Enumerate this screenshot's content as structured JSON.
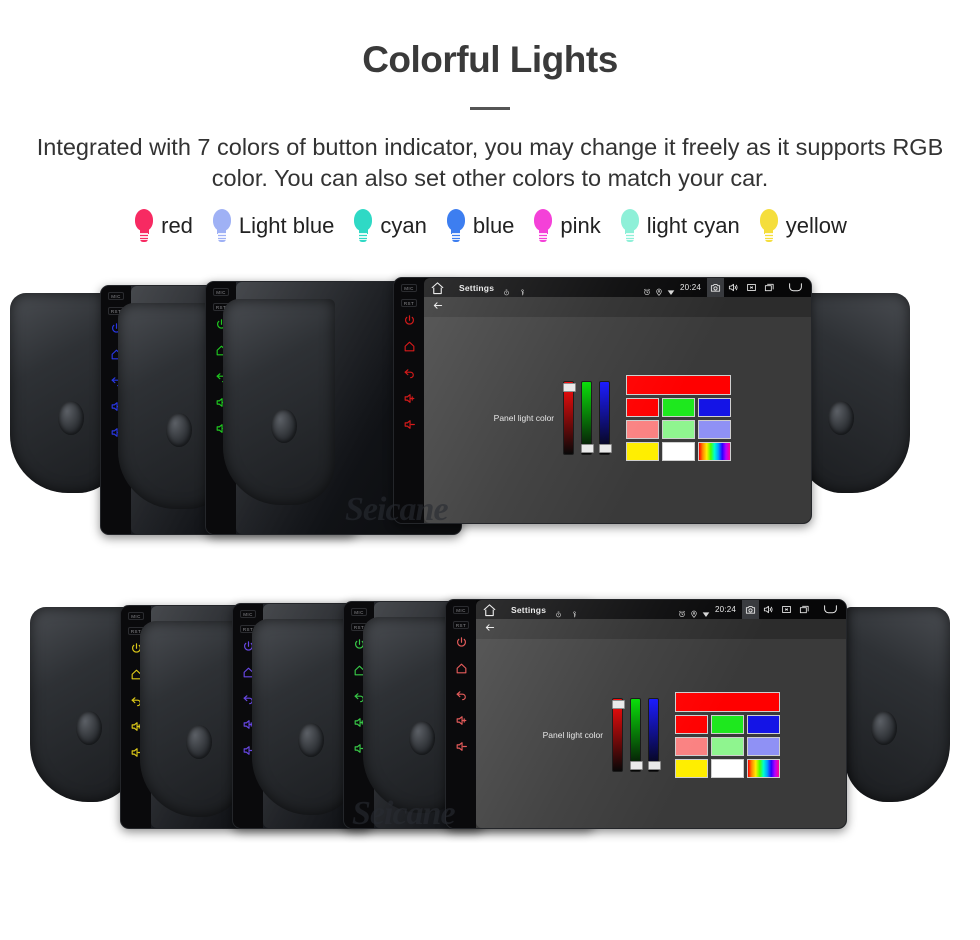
{
  "header": {
    "title": "Colorful Lights",
    "description": "Integrated with 7 colors of button indicator, you may change it freely as it supports RGB color. You can also set other colors to match your car."
  },
  "legend": {
    "items": [
      {
        "label": "red",
        "color": "#f72a62",
        "icon": "bulb-icon"
      },
      {
        "label": "Light blue",
        "color": "#9fb1f5",
        "icon": "bulb-icon"
      },
      {
        "label": "cyan",
        "color": "#2fd9c5",
        "icon": "bulb-icon"
      },
      {
        "label": "blue",
        "color": "#3d7ef0",
        "icon": "bulb-icon"
      },
      {
        "label": "pink",
        "color": "#f441d8",
        "icon": "bulb-icon"
      },
      {
        "label": "light cyan",
        "color": "#8ef0d8",
        "icon": "bulb-icon"
      },
      {
        "label": "yellow",
        "color": "#f5de3c",
        "icon": "bulb-icon"
      }
    ]
  },
  "statusbar": {
    "title": "Settings",
    "time": "20:24",
    "icons": [
      "home-icon",
      "stopwatch-icon",
      "key-icon",
      "alarm-icon",
      "location-pin-icon",
      "wifi-icon",
      "camera-icon",
      "volume-icon",
      "close-box-icon",
      "recent-apps-icon",
      "back-arrow-icon"
    ]
  },
  "dialog": {
    "label": "Panel light color",
    "sliders": [
      {
        "name": "red-slider",
        "color": "#ff0000",
        "thumb_position": "top"
      },
      {
        "name": "green-slider",
        "color": "#00dd00",
        "thumb_position": "bottom"
      },
      {
        "name": "blue-slider",
        "color": "#1414ff",
        "thumb_position": "bottom"
      }
    ],
    "preview_color": "#ff0000",
    "swatches": [
      [
        "#ff0000",
        "#1ee81e",
        "#1414e6"
      ],
      [
        "#fa8282",
        "#8ff58f",
        "#8f91f5"
      ],
      [
        "#ffee00",
        "#ffffff",
        "rainbow"
      ]
    ]
  },
  "watermark": "Seicane",
  "groups": [
    {
      "name": "product-group-1",
      "units": [
        {
          "name": "head-unit-blue",
          "button_color": "#2b3bf0"
        },
        {
          "name": "head-unit-green",
          "button_color": "#21d421"
        },
        {
          "name": "head-unit-red",
          "button_color": "#e01b1b"
        }
      ]
    },
    {
      "name": "product-group-2",
      "units": [
        {
          "name": "head-unit-yellow",
          "button_color": "#e8d319"
        },
        {
          "name": "head-unit-purple",
          "button_color": "#6d4bf0"
        },
        {
          "name": "head-unit-green",
          "button_color": "#3bd44b"
        },
        {
          "name": "head-unit-red",
          "button_color": "#f0605f"
        }
      ]
    }
  ],
  "button_icons": [
    "power-icon",
    "home-icon",
    "back-icon",
    "volume-up-icon",
    "volume-down-icon"
  ],
  "bezel_labels": [
    "MIC",
    "RST"
  ]
}
